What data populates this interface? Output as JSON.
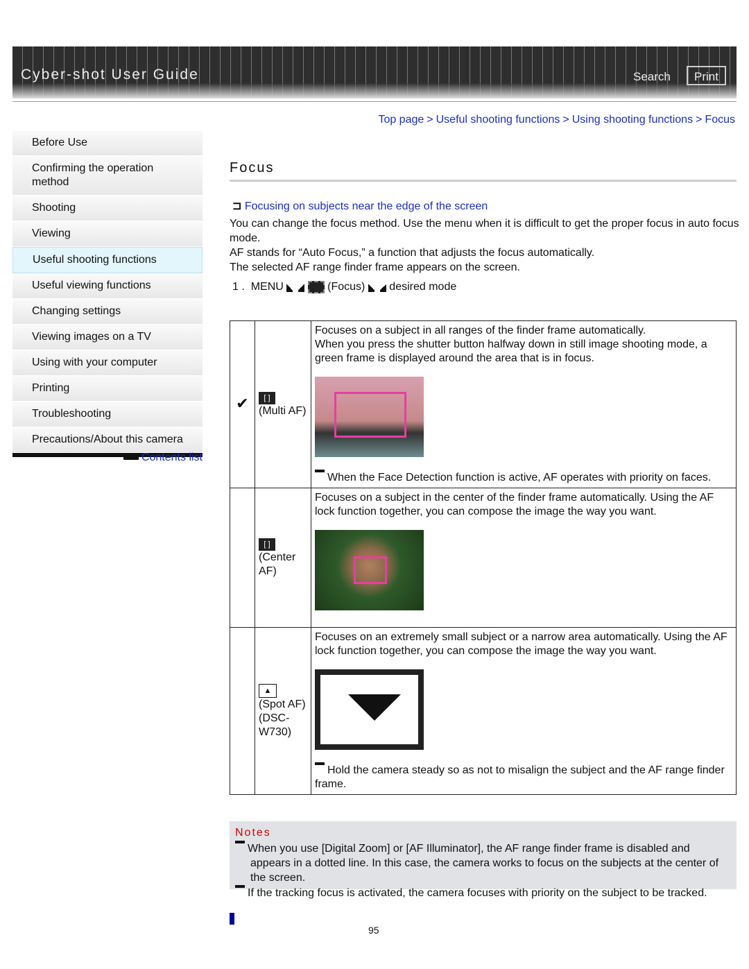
{
  "header": {
    "title": "Cyber-shot User Guide",
    "search": "Search",
    "print": "Print"
  },
  "breadcrumb": [
    "Top page",
    "Useful shooting functions",
    "Using shooting functions",
    "Focus"
  ],
  "sidebar": {
    "items": [
      "Before Use",
      "Confirming the operation method",
      "Shooting",
      "Viewing",
      "Useful shooting functions",
      "Useful viewing functions",
      "Changing settings",
      "Viewing images on a TV",
      "Using with your computer",
      "Printing",
      "Troubleshooting",
      "Precautions/About this camera"
    ],
    "active": "Useful shooting functions",
    "contents_link": "Contents list"
  },
  "page": {
    "title": "Focus",
    "related_link": "Focusing on subjects near the edge of the screen",
    "intro": [
      "You can change the focus method. Use the menu when it is difficult to get the proper focus in auto focus mode.",
      "AF stands for “Auto Focus,” a function that adjusts the focus automatically.",
      "The selected AF range finder frame appears on the screen."
    ],
    "step": {
      "num": "1 .",
      "menu": "MENU",
      "focus": "(Focus)",
      "end": "desired mode"
    }
  },
  "table": [
    {
      "checked": true,
      "mode": "(Multi AF)",
      "desc": [
        "Focuses on a subject in all ranges of the finder frame automatically.",
        "When you press the shutter button halfway down in still image shooting mode, a green frame is displayed around the area that is in focus."
      ],
      "note": "When the Face Detection function is active, AF operates with priority on faces."
    },
    {
      "checked": false,
      "mode": "(Center AF)",
      "desc": [
        "Focuses on a subject in the center of the finder frame automatically. Using the AF lock function together, you can compose the image the way you want."
      ],
      "note": ""
    },
    {
      "checked": false,
      "mode": "(Spot AF) (DSC-W730)",
      "desc": [
        "Focuses on an extremely small subject or a narrow area automatically. Using the AF lock function together, you can compose the image the way you want."
      ],
      "note": "Hold the camera steady so as not to misalign the subject and the AF range finder frame."
    }
  ],
  "notes": {
    "title": "Notes",
    "items": [
      "When you use [Digital Zoom] or [AF Illuminator], the AF range finder frame is disabled and appears in a dotted line. In this case, the camera works to focus on the subjects at the center of the screen.",
      "If the tracking focus is activated, the camera focuses with priority on the subject to be tracked."
    ]
  },
  "page_number": "95",
  "colors": {
    "link": "#1a2ec8",
    "notes_title": "#d40000",
    "notes_bg": "#e0e2e6"
  }
}
